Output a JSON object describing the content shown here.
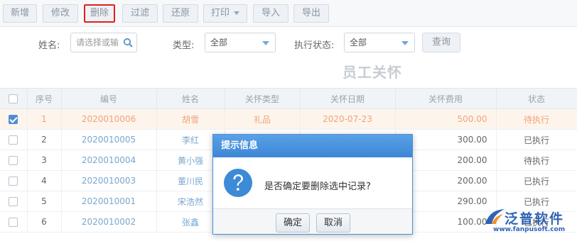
{
  "toolbar": {
    "buttons": [
      "新增",
      "修改",
      "删除",
      "过滤",
      "还原",
      "打印",
      "导入",
      "导出"
    ]
  },
  "filters": {
    "name_label": "姓名:",
    "name_placeholder": "请选择或输",
    "type_label": "类型:",
    "type_value": "全部",
    "status_label": "执行状态:",
    "status_value": "全部",
    "query_label": "查询"
  },
  "page_title": "员工关怀",
  "table": {
    "headers": [
      "序号",
      "编号",
      "姓名",
      "关怀类型",
      "关怀日期",
      "关怀费用",
      "状态"
    ],
    "rows": [
      {
        "seq": "1",
        "code": "2020010006",
        "name": "胡雪",
        "type": "礼品",
        "date": "2020-07-23",
        "fee": "500.00",
        "status": "待执行",
        "checked": true
      },
      {
        "seq": "2",
        "code": "2020010005",
        "name": "李红",
        "type": "",
        "date": "",
        "fee": "300.00",
        "status": "已执行",
        "checked": false
      },
      {
        "seq": "3",
        "code": "2020010004",
        "name": "黄小强",
        "type": "",
        "date": "",
        "fee": "200.00",
        "status": "待执行",
        "checked": false
      },
      {
        "seq": "4",
        "code": "2020010003",
        "name": "董川民",
        "type": "",
        "date": "",
        "fee": "200.00",
        "status": "已执行",
        "checked": false
      },
      {
        "seq": "5",
        "code": "2020010001",
        "name": "宋浩然",
        "type": "",
        "date": "",
        "fee": "290.00",
        "status": "已执行",
        "checked": false
      },
      {
        "seq": "6",
        "code": "2020010002",
        "name": "张鑫",
        "type": "",
        "date": "",
        "fee": "100.00",
        "status": "已执行",
        "checked": false
      }
    ]
  },
  "dialog": {
    "title": "提示信息",
    "message": "是否确定要删除选中记录?",
    "ok_label": "确定",
    "cancel_label": "取消"
  },
  "logo": {
    "brand": "泛普软件",
    "url": "www.fanpusoft.com"
  },
  "colors": {
    "accent": "#4b8fd8",
    "highlight_border": "#e02020",
    "selected_row_text": "#f0a27a",
    "link_text": "#7aa6cf"
  }
}
